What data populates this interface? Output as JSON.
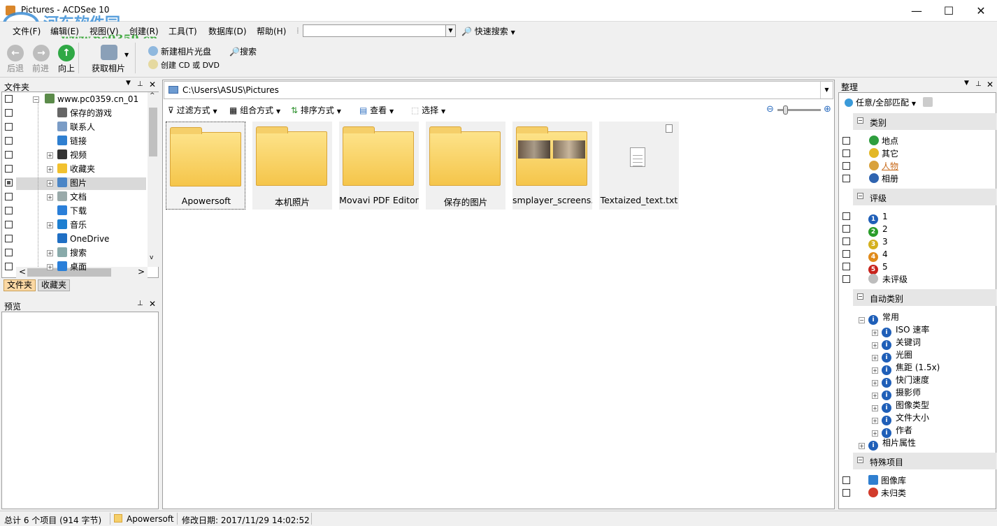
{
  "window": {
    "title": "Pictures - ACDSee 10",
    "minimize": "—",
    "maximize": "☐",
    "close": "✕"
  },
  "watermark": {
    "line1": "河东软件园",
    "line2": "www.pc0359.cn"
  },
  "menu": [
    "文件(F)",
    "编辑(E)",
    "视图(V)",
    "创建(R)",
    "工具(T)",
    "数据库(D)",
    "帮助(H)"
  ],
  "quick_search": {
    "value": "",
    "label": "快速搜索"
  },
  "toolbar": {
    "back": "后退",
    "forward": "前进",
    "up": "向上",
    "acquire": "获取相片",
    "new_disc": "新建相片光盘",
    "search": "搜索",
    "create_cd": "创建 CD 或 DVD"
  },
  "folders_panel": {
    "title": "文件夹",
    "items": [
      {
        "label": "www.pc0359.cn_01",
        "icon": "user-icon"
      },
      {
        "label": "保存的游戏",
        "icon": "games-icon"
      },
      {
        "label": "联系人",
        "icon": "contacts-icon"
      },
      {
        "label": "链接",
        "icon": "links-icon"
      },
      {
        "label": "视频",
        "icon": "video-icon"
      },
      {
        "label": "收藏夹",
        "icon": "star-icon"
      },
      {
        "label": "图片",
        "icon": "pictures-icon"
      },
      {
        "label": "文档",
        "icon": "documents-icon"
      },
      {
        "label": "下载",
        "icon": "download-icon"
      },
      {
        "label": "音乐",
        "icon": "music-icon"
      },
      {
        "label": "OneDrive",
        "icon": "cloud-icon"
      },
      {
        "label": "搜索",
        "icon": "search-icon"
      },
      {
        "label": "桌面",
        "icon": "desktop-icon"
      }
    ],
    "tabs": [
      "文件夹",
      "收藏夹"
    ]
  },
  "preview_panel": {
    "title": "预览"
  },
  "path": {
    "value": "C:\\Users\\ASUS\\Pictures"
  },
  "browser_toolbar": {
    "filter": "过滤方式",
    "group": "组合方式",
    "sort": "排序方式",
    "view": "查看",
    "select": "选择"
  },
  "zoom": {
    "level": 0.15
  },
  "files": [
    {
      "name": "Apowersoft",
      "type": "folder"
    },
    {
      "name": "本机照片",
      "type": "folder"
    },
    {
      "name": "Movavi PDF Editor",
      "type": "folder"
    },
    {
      "name": "保存的图片",
      "type": "folder"
    },
    {
      "name": "smplayer_screens...",
      "type": "folder-photos"
    },
    {
      "name": "Textaized_text.txt",
      "type": "text"
    }
  ],
  "organize_panel": {
    "title": "整理",
    "match": "任意/全部匹配",
    "categories": {
      "title": "类别",
      "items": [
        "地点",
        "其它",
        "人物",
        "相册"
      ]
    },
    "ratings": {
      "title": "评级",
      "items": [
        "1",
        "2",
        "3",
        "4",
        "5",
        "未评级"
      ]
    },
    "auto_categories": {
      "title": "自动类别",
      "common": "常用",
      "items": [
        "ISO 速率",
        "关键词",
        "光圈",
        "焦距 (1.5x)",
        "快门速度",
        "摄影师",
        "图像类型",
        "文件大小",
        "作者"
      ],
      "photo_props": "相片属性"
    },
    "special": {
      "title": "特殊项目",
      "items": [
        "图像库",
        "未归类"
      ]
    }
  },
  "status": {
    "total": "总计 6 个项目 (914 字节)",
    "selected": "Apowersoft",
    "modified": "修改日期: 2017/11/29 14:02:52"
  },
  "colors": {
    "rating1": "#1f5fb8",
    "rating2": "#2a9d2a",
    "rating3": "#d4b01e",
    "rating4": "#e08a1a",
    "rating5": "#c8231c",
    "unrated": "#bdbdbd",
    "people_link": "#c86a1a"
  }
}
